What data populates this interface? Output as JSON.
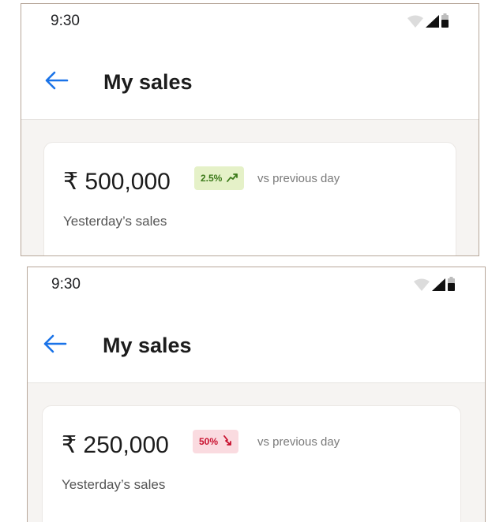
{
  "screens": [
    {
      "status_time": "9:30",
      "title": "My sales",
      "sales_amount": "₹ 500,000",
      "change_percent": "2.5%",
      "change_direction": "up",
      "comparison_text": "vs previous day",
      "sales_label": "Yesterday’s sales"
    },
    {
      "status_time": "9:30",
      "title": "My sales",
      "sales_amount": "₹ 250,000",
      "change_percent": "50%",
      "change_direction": "down",
      "comparison_text": "vs previous day",
      "sales_label": "Yesterday’s sales"
    }
  ],
  "icons": {
    "back": "arrow-left-icon",
    "wifi": "wifi-icon",
    "signal": "cellular-signal-icon",
    "battery": "battery-icon",
    "trend_up": "trending-up-icon",
    "trend_down": "trending-down-icon"
  },
  "colors": {
    "accent": "#1a73e8",
    "positive_bg": "#e5f1c8",
    "positive_text": "#3c7a1a",
    "negative_bg": "#fadbe0",
    "negative_text": "#c8102e"
  }
}
